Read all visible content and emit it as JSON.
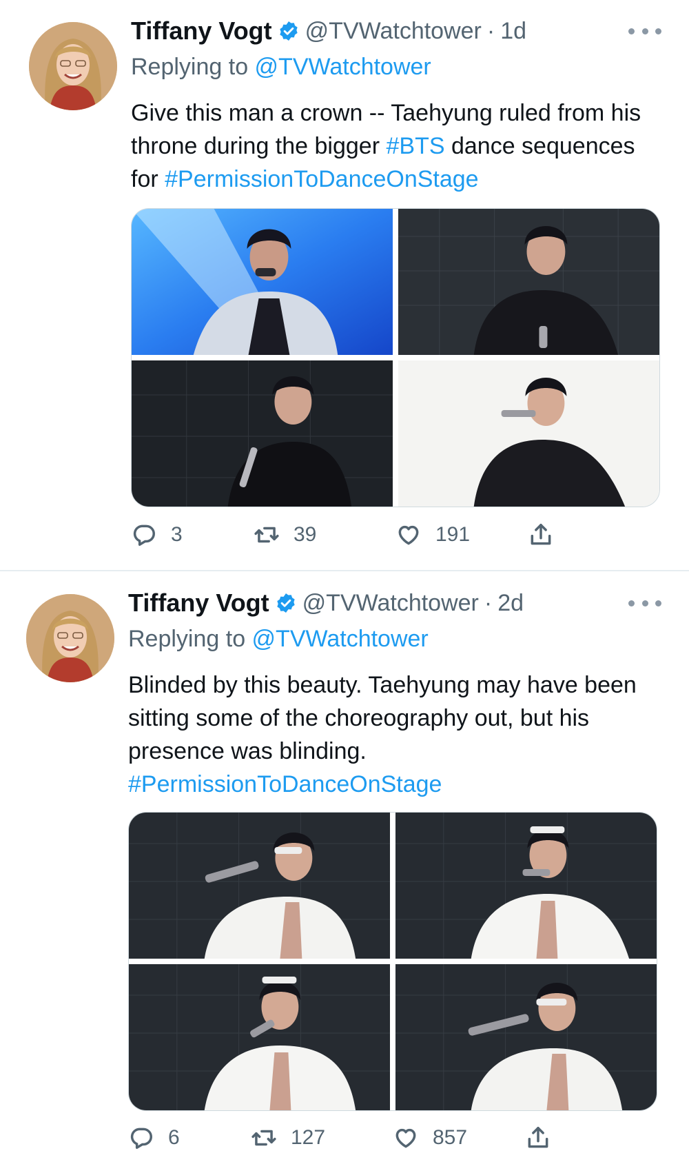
{
  "colors": {
    "accent": "#1d9bf0",
    "muted": "#536471",
    "text": "#0f1419",
    "divider": "#e6ecf0"
  },
  "tweets": [
    {
      "author": {
        "name": "Tiffany Vogt",
        "handle": "@TVWatchtower",
        "verified": true,
        "avatar_icon": "profile-photo"
      },
      "separator": "·",
      "time": "1d",
      "replying_prefix": "Replying to ",
      "replying_to": "@TVWatchtower",
      "text": {
        "part1": "Give this man a crown -- Taehyung ruled from his throne during the bigger ",
        "hashtag1": "#BTS",
        "part2": " dance sequences for ",
        "hashtag2": "#PermissionToDanceOnStage"
      },
      "media": [
        "concert photo 1",
        "concert photo 2",
        "concert photo 3",
        "concert photo 4"
      ],
      "stats": {
        "replies": "3",
        "retweets": "39",
        "likes": "191"
      },
      "icons": {
        "reply": "reply-icon",
        "retweet": "retweet-icon",
        "like": "heart-icon",
        "share": "share-icon",
        "more": "more-icon"
      }
    },
    {
      "author": {
        "name": "Tiffany Vogt",
        "handle": "@TVWatchtower",
        "verified": true,
        "avatar_icon": "profile-photo"
      },
      "separator": "·",
      "time": "2d",
      "replying_prefix": "Replying to ",
      "replying_to": "@TVWatchtower",
      "text": {
        "part1": "Blinded by this beauty. Taehyung may have been sitting some of the choreography out, but his presence was blinding. ",
        "hashtag1": "#PermissionToDanceOnStage"
      },
      "media": [
        "concert photo 1",
        "concert photo 2",
        "concert photo 3",
        "concert photo 4"
      ],
      "stats": {
        "replies": "6",
        "retweets": "127",
        "likes": "857"
      },
      "icons": {
        "reply": "reply-icon",
        "retweet": "retweet-icon",
        "like": "heart-icon",
        "share": "share-icon",
        "more": "more-icon"
      }
    }
  ]
}
